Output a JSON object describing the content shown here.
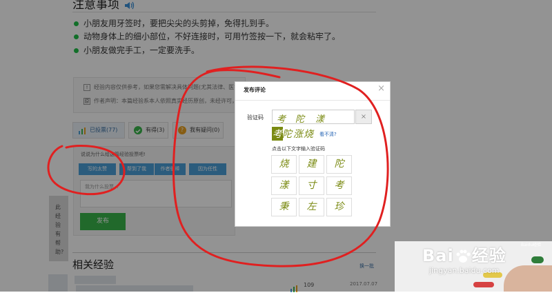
{
  "notes": {
    "title": "注意事项",
    "speaker_icon": "speaker-icon",
    "items": [
      "小朋友用牙签时，要把尖尖的头剪掉，免得扎到手。",
      "动物身体上的细小部位，不好连接时，可用竹签按一下，就会粘牢了。",
      "小朋友做完手工，一定要洗手。"
    ]
  },
  "disclaimer": {
    "row1": "经验内容仅供参考，如果您需解决具体问题(尤其法律、医学",
    "row1_icon": "!",
    "row2": "作者声明：本篇经验系本人依照真实经历原创，未经许可，",
    "row2_icon": "原"
  },
  "votes": {
    "voted": "已投票(77)",
    "useful": "有得(3)",
    "question": "我有疑问(0)"
  },
  "reason": {
    "prompt": "说说为什么给这篇经验投票吧!",
    "tags": [
      "写的太赞",
      "帮到了我",
      "作者很棒",
      "因为任性"
    ],
    "input_placeholder": "我为什么投票...",
    "publish": "发布"
  },
  "side_tab": {
    "text": "此经验有帮助?"
  },
  "related": {
    "title": "相关经验",
    "swap": "换一批",
    "count": "109",
    "date": "2017.07.07"
  },
  "modal": {
    "title": "发布评论",
    "close": "×",
    "captcha_label": "验证码",
    "captcha_chars": [
      "考",
      "陀",
      "漾"
    ],
    "clear": "×",
    "preview_chars": [
      "考",
      "陀",
      "涨",
      "烧"
    ],
    "refresh": "看不清?",
    "hint": "点击以下文字输入验证码",
    "grid": [
      [
        "烧",
        "建",
        "陀"
      ],
      [
        "漾",
        "寸",
        "考"
      ],
      [
        "秉",
        "左",
        "珍"
      ]
    ]
  },
  "watermark": {
    "logo_prefix": "Bai",
    "logo_suffix": "经验",
    "url": "jingyan.baidu.com",
    "tiny": "Baidu经验"
  },
  "colors": {
    "green": "#1fbf48",
    "publish_green": "#39b54a",
    "tag_blue": "#4a9fd8",
    "link_blue": "#2463b4",
    "captcha_olive": "#7a8a12",
    "scribble_red": "#e02020"
  }
}
